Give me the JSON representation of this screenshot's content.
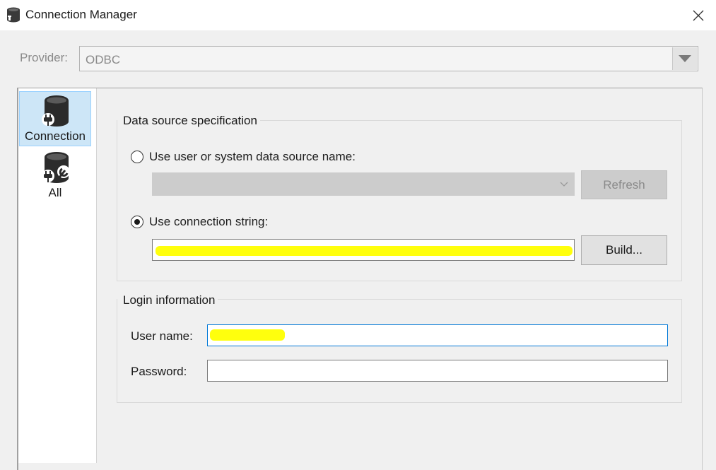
{
  "window": {
    "title": "Connection Manager",
    "icon": "database-icon",
    "close_icon": "close-icon"
  },
  "provider": {
    "label": "Provider:",
    "value": "ODBC"
  },
  "nav": {
    "items": [
      {
        "label": "Connection",
        "icon": "database-plug-icon",
        "selected": true
      },
      {
        "label": "All",
        "icon": "database-wrench-icon",
        "selected": false
      }
    ]
  },
  "data_source": {
    "group_title": "Data source specification",
    "dsn_option_label": "Use user or system data source name:",
    "dsn_selected": false,
    "dsn_value": "",
    "refresh_label": "Refresh",
    "conn_string_option_label": "Use connection string:",
    "conn_string_selected": true,
    "conn_string_value": "",
    "build_label": "Build..."
  },
  "login": {
    "group_title": "Login information",
    "username_label": "User name:",
    "username_value": "",
    "password_label": "Password:",
    "password_value": ""
  },
  "colors": {
    "selection_bg": "#cde6f7",
    "focus_border": "#0078d7",
    "redaction": "#ffff00"
  }
}
